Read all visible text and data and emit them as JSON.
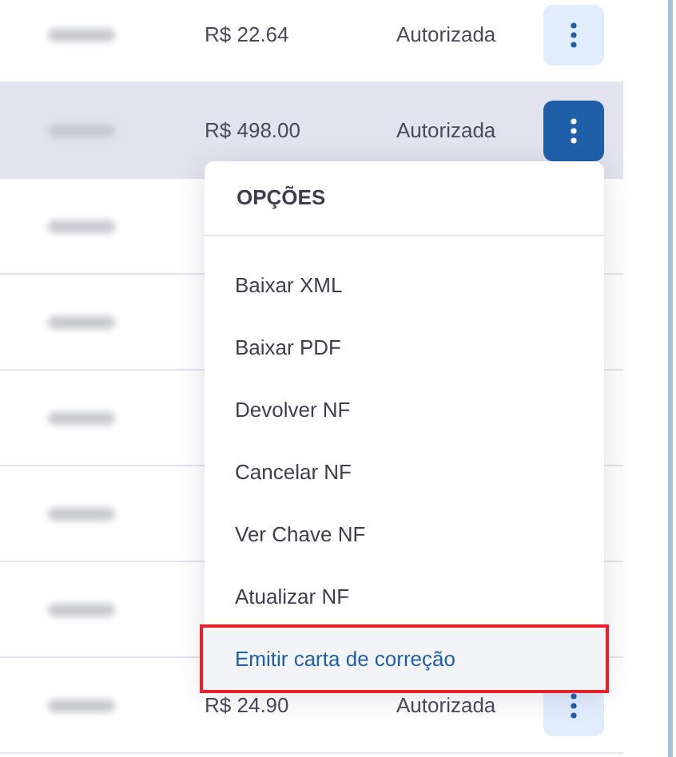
{
  "rows": [
    {
      "amount": "R$ 22.64",
      "status": "Autorizada",
      "selected": false,
      "menu_open": false
    },
    {
      "amount": "R$ 498.00",
      "status": "Autorizada",
      "selected": true,
      "menu_open": true
    },
    {
      "selected": false
    },
    {
      "selected": false
    },
    {
      "selected": false
    },
    {
      "selected": false
    },
    {
      "selected": false
    },
    {
      "amount": "R$ 24.90",
      "status": "Autorizada",
      "selected": false,
      "menu_open": false
    }
  ],
  "menu": {
    "title": "OPÇÕES",
    "items": [
      {
        "label": "Baixar XML",
        "highlighted": false
      },
      {
        "label": "Baixar PDF",
        "highlighted": false
      },
      {
        "label": "Devolver NF",
        "highlighted": false
      },
      {
        "label": "Cancelar NF",
        "highlighted": false
      },
      {
        "label": "Ver Chave NF",
        "highlighted": false
      },
      {
        "label": "Atualizar NF",
        "highlighted": false
      },
      {
        "label": "Emitir carta de correção",
        "highlighted": true
      }
    ]
  }
}
